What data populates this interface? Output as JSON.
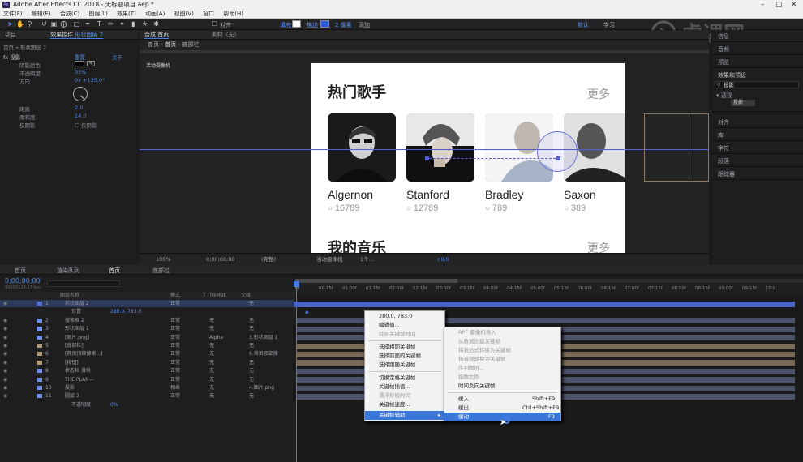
{
  "app": {
    "title": "Adobe After Effects CC 2018 - 无标题项目.aep *",
    "menu": [
      "文件(F)",
      "编辑(E)",
      "合成(C)",
      "图层(L)",
      "效果(T)",
      "动画(A)",
      "视图(V)",
      "窗口",
      "帮助(H)"
    ]
  },
  "toolbar": {
    "align_label": "对齐",
    "fill_label": "填充",
    "stroke_label": "描边",
    "stroke_px": "2 像素",
    "add_label": "添加",
    "workspace_default": "默认",
    "workspace_learn": "学习"
  },
  "effect_controls": {
    "tab_project": "项目",
    "tab_effects": "效果控件",
    "tab_effects_layer": "形状图层 2",
    "header_path": "首页 • 形状图层 2",
    "fx_name": "投影",
    "reset": "重置",
    "about": "关于",
    "rows": [
      {
        "label": "阴影颜色",
        "value": ""
      },
      {
        "label": "不透明度",
        "value": "33%"
      },
      {
        "label": "方向",
        "value": "0x +135.0°"
      },
      {
        "label": "距离",
        "value": "2.0"
      },
      {
        "label": "柔和度",
        "value": "14.0"
      },
      {
        "label": "仅阴影",
        "value": "仅阴影"
      }
    ]
  },
  "comp_panel": {
    "tab_label": "合成 首页",
    "breadcrumb_1": "首页",
    "breadcrumb_2": "底部栏",
    "footage_tab": "素材（无）",
    "camera_label": "活动摄像机",
    "zoom": "100%",
    "timecode": "0;00;00;00",
    "quality": "(完整)",
    "view_camera": "活动摄像机",
    "view_count": "1个...",
    "offset": "+0.0"
  },
  "stage": {
    "section1_title": "热门歌手",
    "section1_more": "更多",
    "section2_title": "我的音乐",
    "section2_more": "更多",
    "singers": [
      {
        "name": "Algernon",
        "count": "16789"
      },
      {
        "name": "Stanford",
        "count": "12789"
      },
      {
        "name": "Bradley",
        "count": "789"
      },
      {
        "name": "Saxon",
        "count": "389"
      }
    ]
  },
  "right_panel": {
    "items_top": [
      "信息",
      "音频",
      "预览",
      "效果和预设"
    ],
    "search_value": "投影",
    "tree_parent": "透视",
    "tree_child": "投影",
    "items_bottom": [
      "对齐",
      "库",
      "字符",
      "段落",
      "跟踪器"
    ]
  },
  "timeline": {
    "tabs": [
      "首页",
      "渲染队列",
      "首页",
      "底部栏"
    ],
    "timecode": "0;00;00;00",
    "fps": "00000 (29.97 fps)",
    "col_name": "图层名称",
    "col_mode": "模式",
    "col_t": "T",
    "col_trkmat": "TrkMat",
    "col_parent": "父级",
    "ruler": [
      "0f",
      "00:15f",
      "01:00f",
      "01:15f",
      "02:00f",
      "02:15f",
      "03:00f",
      "03:15f",
      "04:00f",
      "04:15f",
      "05:00f",
      "05:15f",
      "06:00f",
      "06:15f",
      "07:00f",
      "07:15f",
      "08:00f",
      "08:15f",
      "09:00f",
      "09:15f",
      "10:0"
    ],
    "layers": [
      {
        "num": "1",
        "name": "形状图层 2",
        "mode": "正常",
        "trkmat": "",
        "parent": "无",
        "color": "#5a6fd6"
      },
      {
        "num": "",
        "name": "位置",
        "mode": "",
        "trkmat": "",
        "parent": "",
        "value": "280.0, 783.0",
        "color": ""
      },
      {
        "num": "2",
        "name": "搜索框 2",
        "mode": "正常",
        "trkmat": "无",
        "parent": "无",
        "color": "#6e8ef0"
      },
      {
        "num": "3",
        "name": "形状图层 1",
        "mode": "正常",
        "trkmat": "无",
        "parent": "无",
        "color": "#6e8ef0"
      },
      {
        "num": "4",
        "name": "[图片.png]",
        "mode": "正常",
        "trkmat": "Alpha",
        "parent": "3.形状图层 1",
        "color": "#6e8ef0"
      },
      {
        "num": "5",
        "name": "[底部栏]",
        "mode": "正常",
        "trkmat": "无",
        "parent": "无",
        "color": "#b19a7c"
      },
      {
        "num": "6",
        "name": "[首页顶部搜索...]",
        "mode": "正常",
        "trkmat": "无",
        "parent": "6.首页顶部搜",
        "color": "#b19a7c"
      },
      {
        "num": "7",
        "name": "[按钮]",
        "mode": "正常",
        "trkmat": "无",
        "parent": "无",
        "color": "#b19a7c"
      },
      {
        "num": "8",
        "name": "状态栏 滑块",
        "mode": "正常",
        "trkmat": "无",
        "parent": "无",
        "color": "#6e8ef0"
      },
      {
        "num": "9",
        "name": "THE PLAN—",
        "mode": "正常",
        "trkmat": "无",
        "parent": "无",
        "color": "#6e8ef0"
      },
      {
        "num": "10",
        "name": "投影",
        "mode": "相乘",
        "trkmat": "无",
        "parent": "4.图片.png",
        "color": "#6e8ef0"
      },
      {
        "num": "11",
        "name": "圆层 2",
        "mode": "正常",
        "trkmat": "无",
        "parent": "无",
        "color": "#6e8ef0"
      },
      {
        "num": "",
        "name": "不透明度",
        "mode": "",
        "trkmat": "",
        "parent": "",
        "value": "0%",
        "color": ""
      }
    ]
  },
  "context_menu": {
    "header": "280.0, 783.0",
    "items": [
      {
        "label": "编辑值...",
        "disabled": false
      },
      {
        "label": "转到关键帧时间",
        "disabled": true
      },
      {
        "label": "选择相同关键帧",
        "disabled": false
      },
      {
        "label": "选择前面的关键帧",
        "disabled": false
      },
      {
        "label": "选择跟随关键帧",
        "disabled": false
      },
      {
        "label": "切换定格关键帧",
        "disabled": false
      },
      {
        "label": "关键帧插值...",
        "disabled": false
      },
      {
        "label": "漂浮穿梭时间",
        "disabled": true
      },
      {
        "label": "关键帧速度...",
        "disabled": false
      },
      {
        "label": "关键帧辅助",
        "disabled": false,
        "highlighted": true
      }
    ],
    "submenu": [
      {
        "label": "RPF 摄像机导入",
        "shortcut": "",
        "disabled": true
      },
      {
        "label": "从数据创建关键帧",
        "shortcut": "",
        "disabled": true
      },
      {
        "label": "将表达式转换为关键帧",
        "shortcut": "",
        "disabled": true
      },
      {
        "label": "将音频转换为关键帧",
        "shortcut": "",
        "disabled": true
      },
      {
        "label": "序列图层...",
        "shortcut": "",
        "disabled": true
      },
      {
        "label": "指数比例",
        "shortcut": "",
        "disabled": true
      },
      {
        "label": "时间反向关键帧",
        "shortcut": "",
        "disabled": false
      },
      {
        "label": "缓入",
        "shortcut": "Shift+F9",
        "disabled": false
      },
      {
        "label": "缓出",
        "shortcut": "Ctrl+Shift+F9",
        "disabled": false
      },
      {
        "label": "缓动",
        "shortcut": "F9",
        "disabled": false,
        "highlighted": true
      }
    ]
  },
  "colors": {
    "accent": "#4a7be0",
    "label_blue": "#6e8ef0",
    "label_tan": "#b19a7c",
    "guide": "#5a5fd0"
  }
}
